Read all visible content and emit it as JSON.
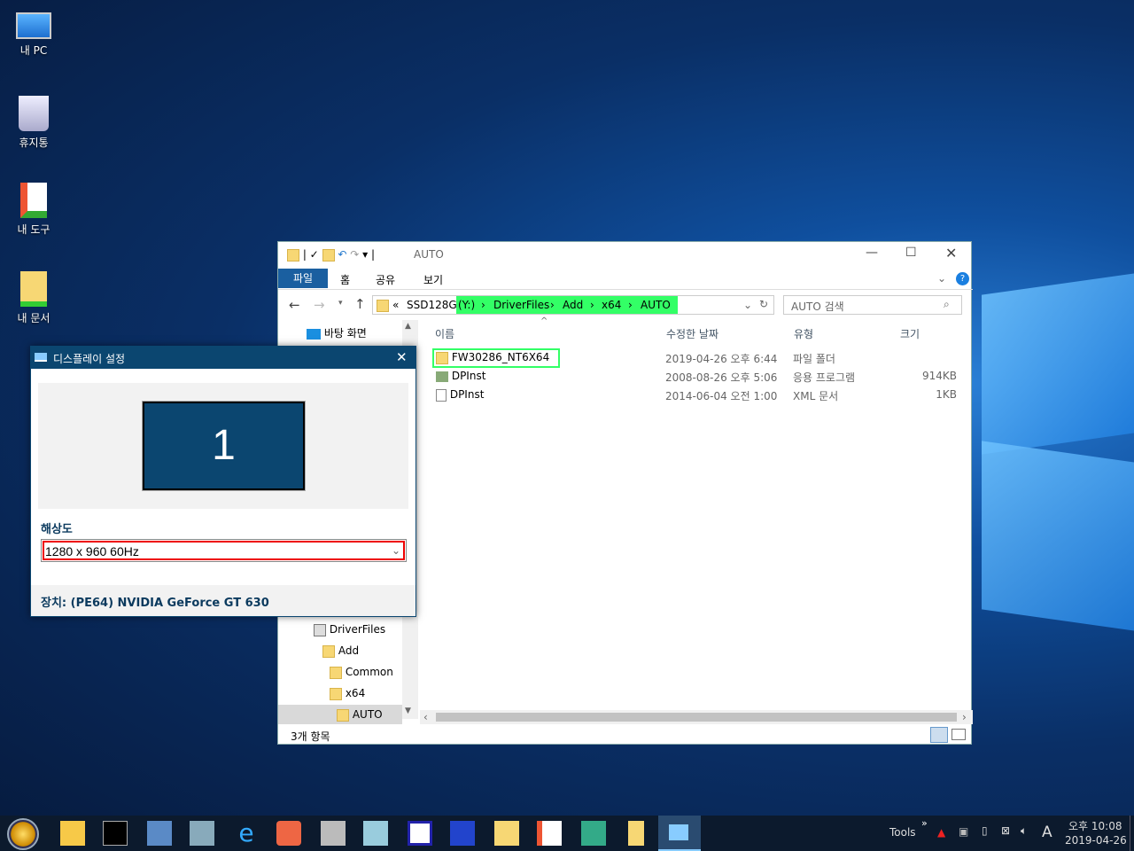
{
  "desktop": {
    "icons": [
      {
        "label": "내 PC",
        "icon": "computer-icon"
      },
      {
        "label": "휴지통",
        "icon": "recycle-bin-icon"
      },
      {
        "label": "내 도구",
        "icon": "tools-shortcut-icon"
      },
      {
        "label": "내 문서",
        "icon": "documents-shortcut-icon"
      }
    ]
  },
  "explorer": {
    "title": "AUTO",
    "ribbon_tabs": [
      "파일",
      "홈",
      "공유",
      "보기"
    ],
    "address": {
      "prefix": "«",
      "segments": [
        "SSD128G",
        "(Y:)",
        "DriverFiles",
        "Add",
        "x64",
        "AUTO"
      ]
    },
    "search_placeholder": "AUTO 검색",
    "columns": [
      "이름",
      "수정한 날짜",
      "유형",
      "크기"
    ],
    "files": [
      {
        "name": "FW30286_NT6X64",
        "date": "2019-04-26 오후 6:44",
        "type": "파일 폴더",
        "size": "",
        "icon": "folder-icon"
      },
      {
        "name": "DPInst",
        "date": "2008-08-26 오후 5:06",
        "type": "응용 프로그램",
        "size": "914KB",
        "icon": "application-icon"
      },
      {
        "name": "DPInst",
        "date": "2014-06-04 오전 1:00",
        "type": "XML 문서",
        "size": "1KB",
        "icon": "xml-file-icon"
      }
    ],
    "nav_top": "바탕 화면",
    "nav_tree": [
      "DriverFiles",
      "Add",
      "Common",
      "x64",
      "AUTO"
    ],
    "status": "3개 항목",
    "highlight_color": "#33ff66"
  },
  "display_dialog": {
    "title": "디스플레이 설정",
    "monitor_number": "1",
    "resolution_label": "해상도",
    "resolution_value": "1280 x 960 60Hz",
    "device_text": "장치: (PE64) NVIDIA GeForce GT 630",
    "accent_color": "#0b4670"
  },
  "taskbar": {
    "tools_label": "Tools",
    "overflow": "»",
    "ime": "A",
    "time": "오후 10:08",
    "date": "2019-04-26"
  }
}
